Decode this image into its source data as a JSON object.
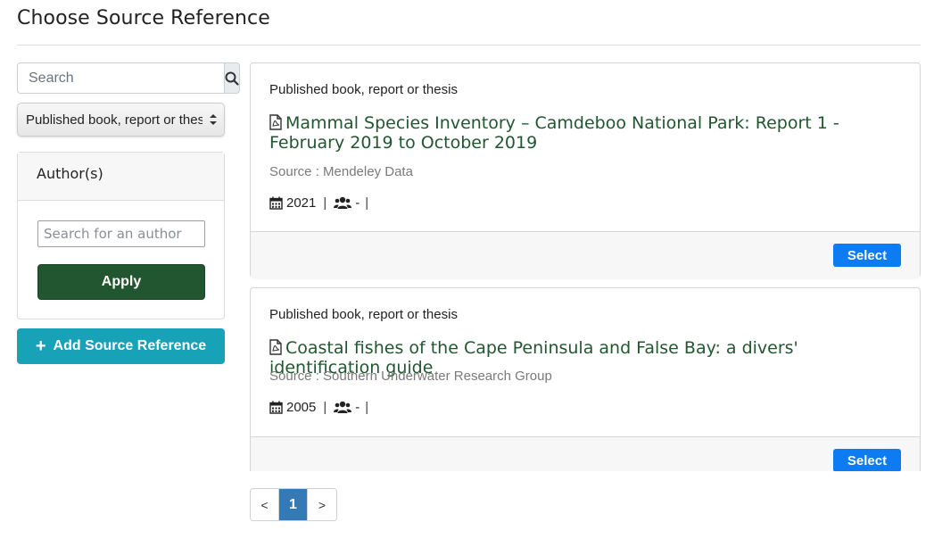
{
  "page": {
    "title": "Choose Source Reference"
  },
  "sidebar": {
    "search_placeholder": "Search",
    "type_filter": "Published book, report or thesis",
    "authors": {
      "heading": "Author(s)",
      "search_placeholder": "Search for an author",
      "apply_label": "Apply"
    },
    "add_reference_label": "Add Source Reference"
  },
  "results": [
    {
      "type": "Published book, report or thesis",
      "title": "Mammal Species Inventory – Camdeboo National Park: Report 1 - February 2019 to October 2019",
      "source": "Source : Mendeley Data",
      "year": "2021",
      "authors": "-",
      "select_label": "Select"
    },
    {
      "type": "Published book, report or thesis",
      "title": "Coastal fishes of the Cape Peninsula and False Bay: a divers' identification guide",
      "source": "Source : Southern Underwater Research Group",
      "year": "2005",
      "authors": "-",
      "select_label": "Select"
    }
  ],
  "pagination": {
    "prev": "<",
    "current": "1",
    "next": ">"
  },
  "colors": {
    "primary_green": "#225630",
    "select_blue": "#0d7bf2",
    "teal": "#17a2b8",
    "page_active": "#337ab7"
  }
}
